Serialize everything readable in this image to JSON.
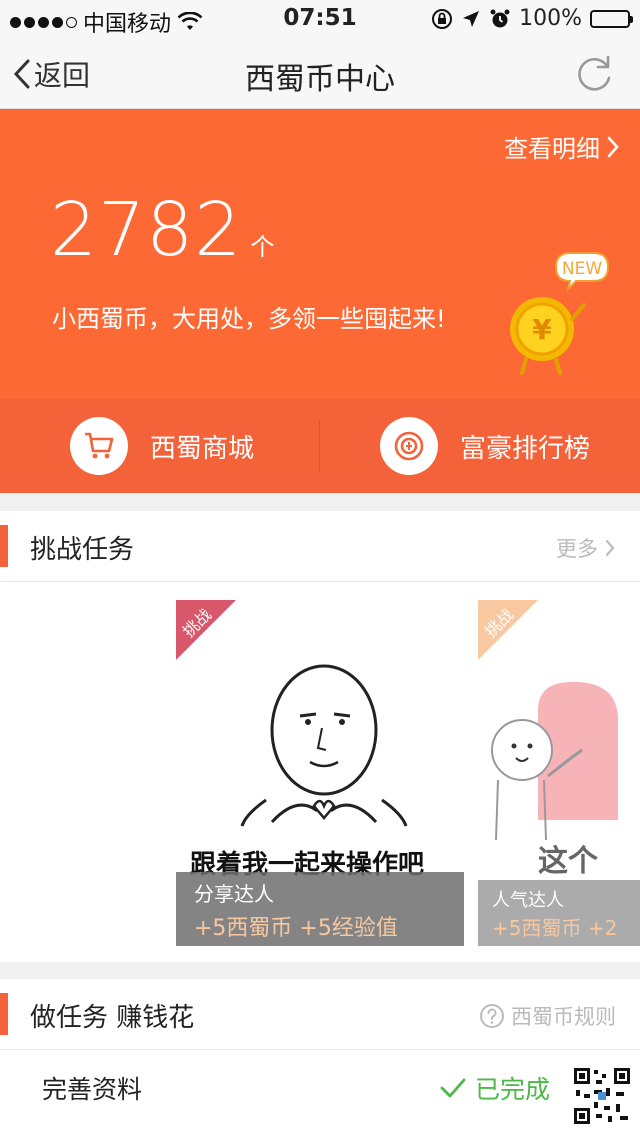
{
  "status_bar": {
    "carrier": "中国移动",
    "time": "07:51",
    "battery": "100%"
  },
  "nav": {
    "back_label": "返回",
    "title": "西蜀币中心"
  },
  "hero": {
    "detail_link": "查看明细",
    "balance": "2782",
    "balance_unit": "个",
    "slogan": "小西蜀币，大用处，多领一些囤起来!",
    "new_badge": "NEW",
    "coin_symbol": "¥",
    "shortcuts": [
      {
        "label": "西蜀商城",
        "icon": "cart-icon"
      },
      {
        "label": "富豪排行榜",
        "icon": "ranking-icon"
      }
    ]
  },
  "challenge": {
    "title": "挑战任务",
    "more": "更多",
    "cards": [
      {
        "ribbon": "挑战",
        "meme_text": "跟着我一起来操作吧",
        "name": "分享达人",
        "reward": "+5西蜀币 +5经验值"
      },
      {
        "ribbon": "挑战",
        "meme_text": "这个",
        "name": "人气达人",
        "reward": "+5西蜀币 +2"
      }
    ]
  },
  "tasks": {
    "title": "做任务 赚钱花",
    "rules": "西蜀币规则",
    "items": [
      {
        "name": "完善资料",
        "status": "已完成"
      }
    ]
  },
  "colors": {
    "accent": "#fd6935",
    "accent_dark": "#f4623a",
    "done_green": "#4cb848"
  }
}
